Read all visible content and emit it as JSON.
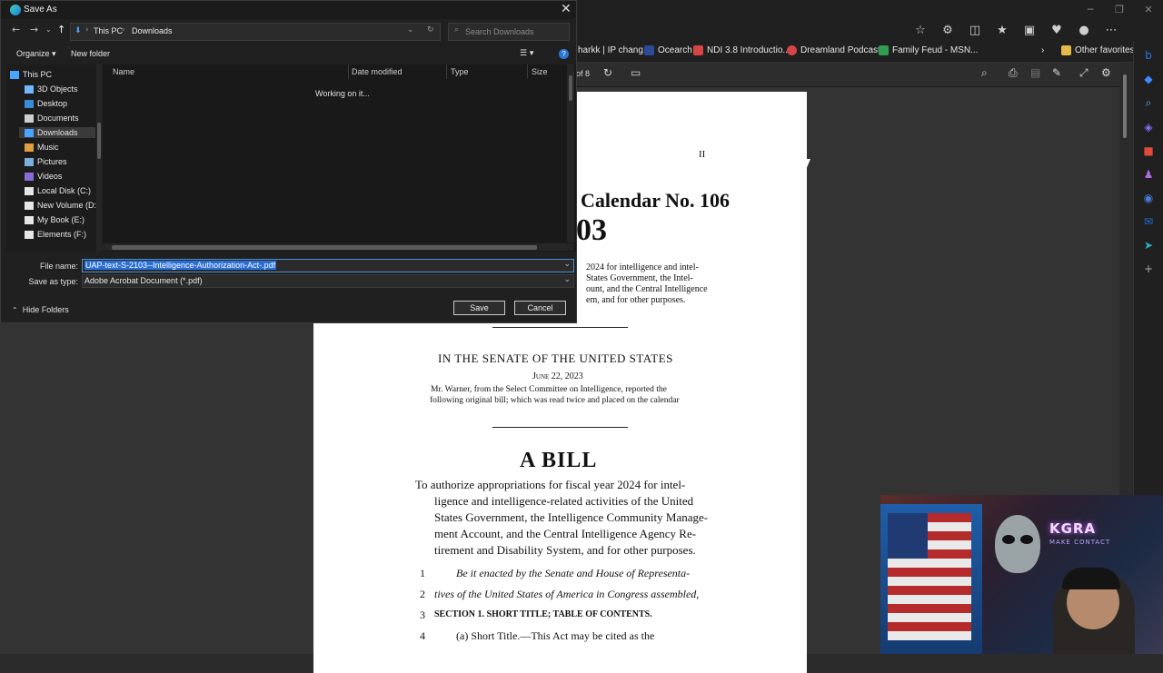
{
  "browser": {
    "favorites": [
      {
        "label": "harkk | IP chang...",
        "color": "#e0e0e0"
      },
      {
        "label": "Ocearch",
        "color": "#ffffff"
      },
      {
        "label": "NDI 3.8 Introductio...",
        "color": "#d64545"
      },
      {
        "label": "Dreamland Podcast...",
        "color": "#d64545"
      },
      {
        "label": "Family Feud - MSN...",
        "color": "#2e9e4f"
      }
    ],
    "other_favorites": "Other favorites",
    "page_counter": "of 8"
  },
  "pdf": {
    "page_mark": "II",
    "calendar": "Calendar No. 106",
    "bill_number": "03",
    "summary_fragment": [
      "2024 for intelligence and intel-",
      "States Government, the Intel-",
      "ount, and the Central Intelligence",
      "em, and for other purposes."
    ],
    "senate": "IN THE SENATE OF THE UNITED STATES",
    "date": "June 22, 2023",
    "reported_lines": [
      "Mr. Warner, from the Select Committee on Intelligence, reported the",
      "following original bill; which was read twice and placed on the calendar"
    ],
    "a_bill": "A BILL",
    "purpose_lines": [
      "To authorize appropriations for fiscal year 2024 for intel-",
      "ligence and intelligence-related activities of the United",
      "States Government, the Intelligence Community Manage-",
      "ment Account, and the Central Intelligence Agency Re-",
      "tirement and Disability System, and for other purposes."
    ],
    "numbered_lines": [
      {
        "num": "1",
        "text": "Be it enacted by the Senate and House of Representa-"
      },
      {
        "num": "2",
        "text": "tives of the United States of America in Congress assembled,"
      },
      {
        "num": "3",
        "text": "SECTION 1. SHORT TITLE; TABLE OF CONTENTS."
      },
      {
        "num": "4",
        "text": "(a) Short Title.—This Act may be cited as the"
      }
    ]
  },
  "webcam": {
    "logo": "KGRA",
    "tagline": "MAKE CONTACT"
  },
  "dialog": {
    "title": "Save As",
    "path": [
      "This PC",
      "Downloads"
    ],
    "search_placeholder": "Search Downloads",
    "organize": "Organize",
    "new_folder": "New folder",
    "nav_items": [
      "This PC",
      "3D Objects",
      "Desktop",
      "Documents",
      "Downloads",
      "Music",
      "Pictures",
      "Videos",
      "Local Disk (C:)",
      "New Volume (D:",
      "My Book (E:)",
      "Elements (F:)"
    ],
    "selected_nav": "Downloads",
    "columns": [
      "Name",
      "Date modified",
      "Type",
      "Size"
    ],
    "status": "Working on it...",
    "file_name_label": "File name:",
    "file_name_value": "UAP-text-S-2103--Intelligence-Authorization-Act-.pdf",
    "save_type_label": "Save as type:",
    "save_type_value": "Adobe Acrobat Document (*.pdf)",
    "save_button": "Save",
    "cancel_button": "Cancel",
    "hide_folders": "Hide Folders"
  }
}
